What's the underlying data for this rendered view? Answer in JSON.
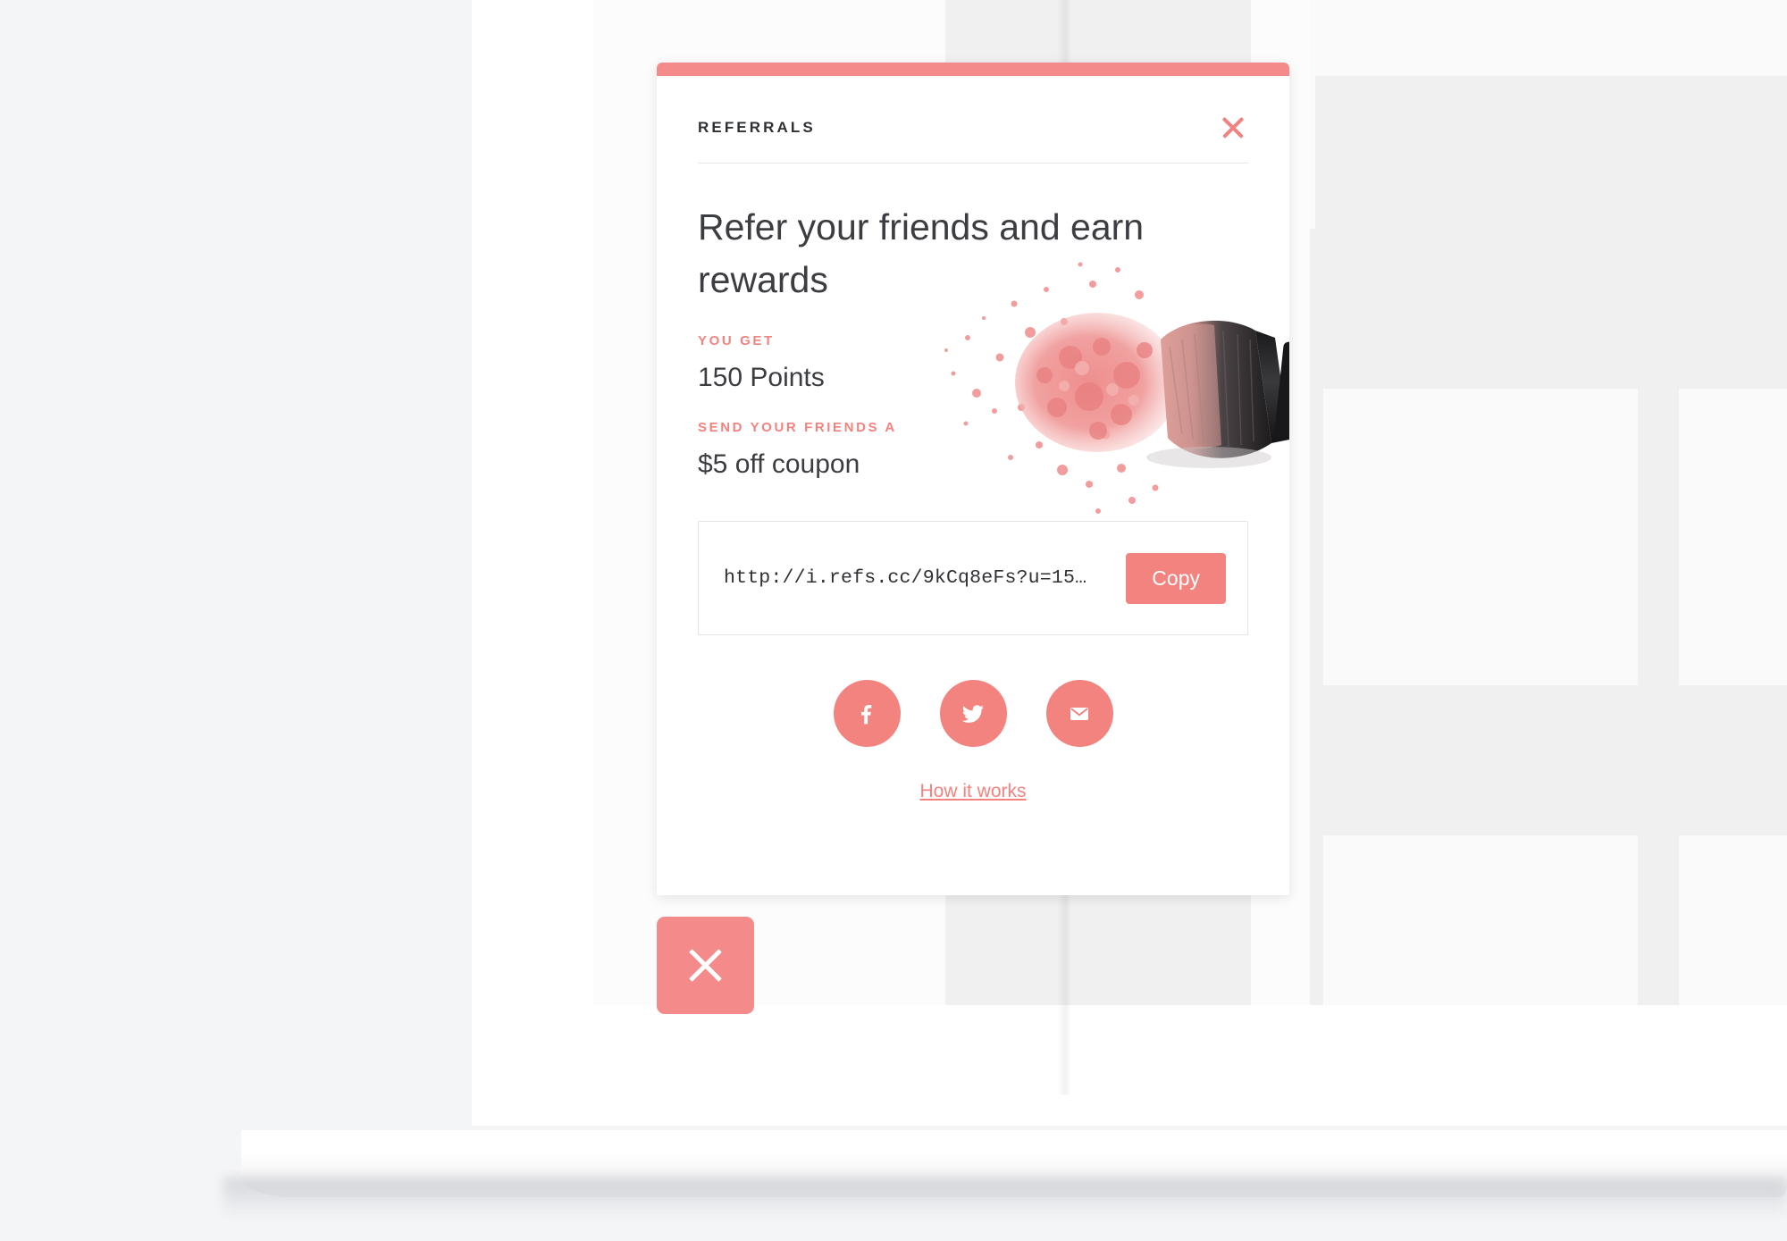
{
  "widget": {
    "header_label": "REFERRALS",
    "close_icon": "close-icon",
    "title": "Refer your friends and earn rewards",
    "you_get_label": "YOU GET",
    "you_get_value": "150 Points",
    "send_friends_label": "SEND YOUR FRIENDS A",
    "send_friends_value": "$5 off coupon",
    "referral_link": "http://i.refs.cc/9kCq8eFs?u=15…",
    "copy_label": "Copy",
    "social": [
      {
        "name": "facebook-icon",
        "label": "Facebook"
      },
      {
        "name": "twitter-icon",
        "label": "Twitter"
      },
      {
        "name": "email-icon",
        "label": "Email"
      }
    ],
    "how_it_works_label": "How it works",
    "background_image": "makeup-brush-with-pink-blush-powder"
  },
  "launcher": {
    "icon": "close-icon",
    "label": "Close referral widget"
  },
  "colors": {
    "accent": "#f58a8a",
    "accent_text": "#f2837f",
    "text_dark": "#3b3d40",
    "page_bg": "#f4f5f7",
    "screen_bg": "#f0f0f0",
    "card_bg": "#ffffff"
  }
}
